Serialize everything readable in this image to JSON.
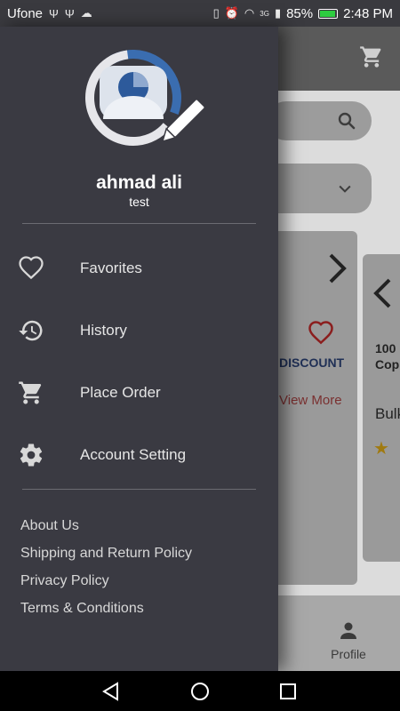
{
  "status": {
    "carrier": "Ufone",
    "battery": "85%",
    "time": "2:48 PM",
    "network": "3G"
  },
  "drawer": {
    "user_name": "ahmad ali",
    "user_sub": "test",
    "menu": [
      {
        "label": "Favorites",
        "icon": "heart-outline-icon"
      },
      {
        "label": "History",
        "icon": "history-icon"
      },
      {
        "label": "Place Order",
        "icon": "cart-icon"
      },
      {
        "label": "Account Setting",
        "icon": "gear-icon"
      }
    ],
    "footer_links": [
      "About Us",
      "Shipping and Return Policy",
      "Privacy Policy",
      "Terms & Conditions"
    ]
  },
  "background_app": {
    "discount_label": "DISCOUNT",
    "view_more": "View More",
    "card2_line1": "100",
    "card2_line2": "Cop",
    "card2_line3": "Bulk",
    "profile_label": "Profile"
  },
  "colors": {
    "drawer_bg": "#3a3a42",
    "accent_blue": "#2d5a9b",
    "heart_red": "#c0392b"
  }
}
